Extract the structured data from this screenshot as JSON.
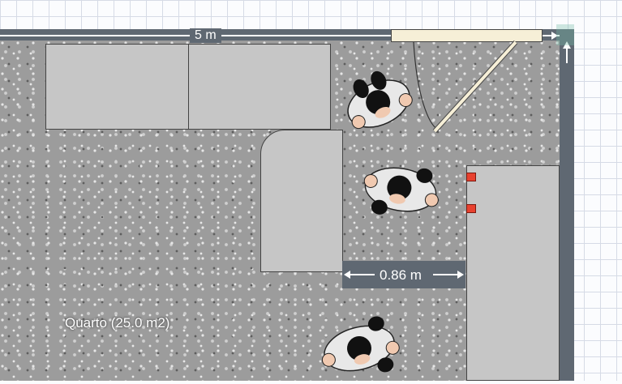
{
  "plan": {
    "top_wall_dimension": "5 m",
    "gap_dimension": "0.86 m",
    "room_label": "Quarto (25.0 m2)"
  },
  "colors": {
    "wall": "#5f6872",
    "furniture": "#c6c6c6",
    "door": "#f6efd7",
    "marker": "#e8412f",
    "grid": "#d6dbe6"
  },
  "icons": [
    "person-icon",
    "arrow-right-icon",
    "arrow-up-icon"
  ]
}
